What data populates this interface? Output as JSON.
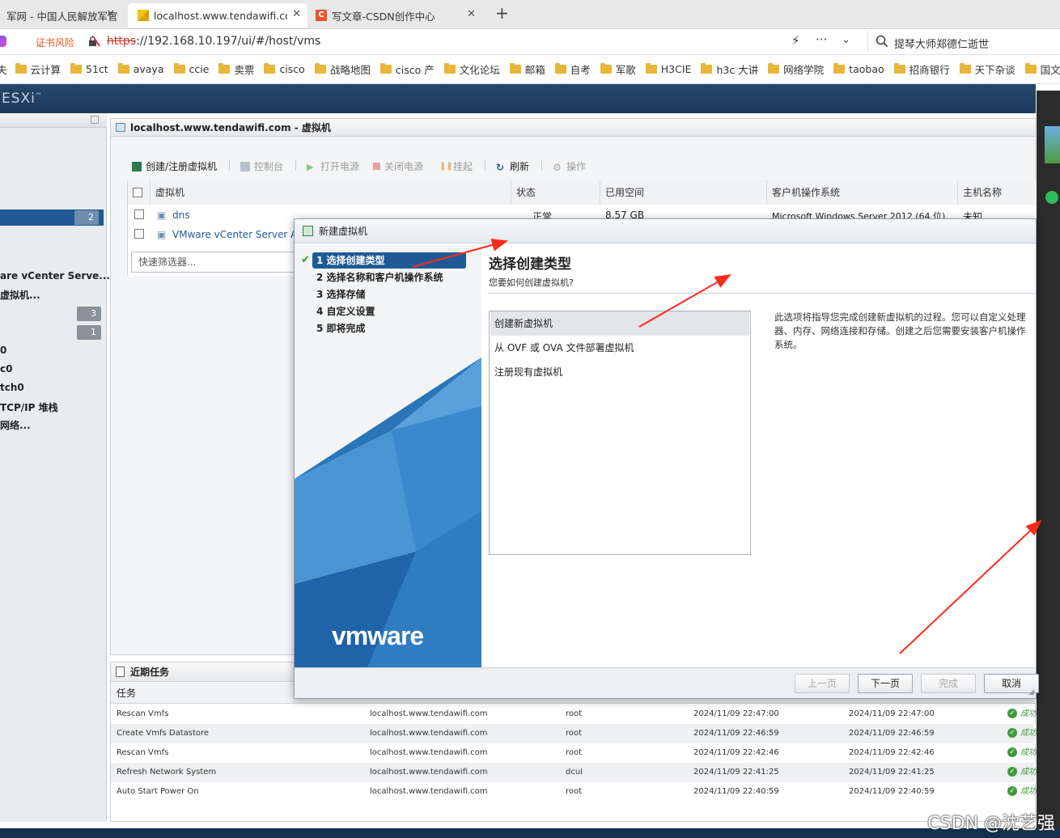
{
  "browser": {
    "tabs": [
      {
        "label": "军网 - 中国人民解放军官"
      },
      {
        "label": "localhost.www.tendawifi.con"
      },
      {
        "label": "写文章-CSDN创作中心"
      }
    ],
    "new_tab": "+",
    "cert_warning": "证书风险",
    "url_scheme": "https",
    "url_rest": "://192.168.10.197/ui/#/host/vms",
    "search_text": "提琴大师郑德仁逝世",
    "bookmarks": [
      "云计算",
      "51ct",
      "avaya",
      "ccie",
      "卖票",
      "cisco",
      "战略地图",
      "cisco 产",
      "文化论坛",
      "邮箱",
      "自考",
      "军歌",
      "H3CIE",
      "h3c 大讲",
      "网络学院",
      "taobao",
      "招商银行",
      "天下杂谈",
      "国文"
    ]
  },
  "esxi": {
    "logo": "ESXi",
    "logo_tm": "™",
    "left_panel": {
      "count_top": "2",
      "items": [
        {
          "label": "are vCenter Serve..."
        },
        {
          "label": "虚拟机..."
        },
        {
          "label": "0"
        },
        {
          "label": "c0"
        },
        {
          "label": "tch0"
        },
        {
          "label": "TCP/IP 堆栈"
        },
        {
          "label": "网络..."
        }
      ],
      "badge_3": "3",
      "badge_1": "1"
    },
    "main_panel": {
      "title": "localhost.www.tendawifi.com - 虚拟机",
      "toolbar": [
        "创建/注册虚拟机",
        "控制台",
        "打开电源",
        "关闭电源",
        "挂起",
        "刷新",
        "操作"
      ],
      "columns": [
        "虚拟机",
        "状态",
        "已用空间",
        "客户机操作系统",
        "主机名称"
      ],
      "rows": [
        {
          "name": "dns",
          "status": "正常",
          "space": "8.57 GB",
          "os": "Microsoft Windows Server 2012 (64 位)",
          "host": "未知"
        },
        {
          "name": "VMware vCenter Server App",
          "status": "",
          "space": "",
          "os": "",
          "host": ""
        }
      ],
      "filter_placeholder": "快速筛选器..."
    },
    "tasks_panel": {
      "title": "近期任务",
      "col_task": "任务",
      "rows": [
        {
          "task": "Rescan Vmfs",
          "target": "localhost.www.tendawifi.com",
          "user": "root",
          "queued": "2024/11/09 22:47:00",
          "started": "2024/11/09 22:47:00",
          "result": "成功完成"
        },
        {
          "task": "Create Vmfs Datastore",
          "target": "localhost.www.tendawifi.com",
          "user": "root",
          "queued": "2024/11/09 22:46:59",
          "started": "2024/11/09 22:46:59",
          "result": "成功完成"
        },
        {
          "task": "Rescan Vmfs",
          "target": "localhost.www.tendawifi.com",
          "user": "root",
          "queued": "2024/11/09 22:42:46",
          "started": "2024/11/09 22:42:46",
          "result": "成功完成"
        },
        {
          "task": "Refresh Network System",
          "target": "localhost.www.tendawifi.com",
          "user": "dcui",
          "queued": "2024/11/09 22:41:25",
          "started": "2024/11/09 22:41:25",
          "result": "成功完成"
        },
        {
          "task": "Auto Start Power On",
          "target": "localhost.www.tendawifi.com",
          "user": "root",
          "queued": "2024/11/09 22:40:59",
          "started": "2024/11/09 22:40:59",
          "result": "成功完成"
        }
      ]
    }
  },
  "wizard": {
    "title": "新建虚拟机",
    "steps": [
      {
        "label": "1 选择创建类型"
      },
      {
        "label": "2 选择名称和客户机操作系统"
      },
      {
        "label": "3 选择存储"
      },
      {
        "label": "4 自定义设置"
      },
      {
        "label": "5 即将完成"
      }
    ],
    "heading": "选择创建类型",
    "subheading": "您要如何创建虚拟机?",
    "options": [
      {
        "label": "创建新虚拟机"
      },
      {
        "label": "从 OVF 或 OVA 文件部署虚拟机"
      },
      {
        "label": "注册现有虚拟机"
      }
    ],
    "description": "此选项将指导您完成创建新虚拟机的过程。您可以自定义处理器、内存、网络连接和存储。创建之后您需要安装客户机操作系统。",
    "logo": "vmware",
    "buttons": {
      "back": "上一页",
      "next": "下一页",
      "finish": "完成",
      "cancel": "取消"
    }
  },
  "watermark": "CSDN @沈艺强",
  "colors": {
    "accent": "#1f5a96",
    "header": "#1d3a5c",
    "annotation": "#ff2a1a",
    "ok": "#3c9a3c"
  }
}
